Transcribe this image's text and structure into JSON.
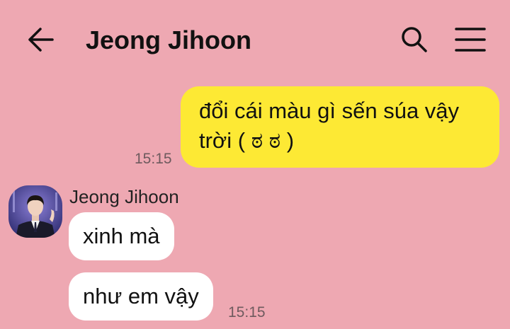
{
  "header": {
    "title": "Jeong Jihoon",
    "back_icon": "arrow-left-icon",
    "search_icon": "search-icon",
    "menu_icon": "hamburger-menu-icon"
  },
  "colors": {
    "background": "#eea8b2",
    "outgoing_bubble": "#fde934",
    "incoming_bubble": "#ffffff"
  },
  "messages": {
    "outgoing_1": {
      "line1": "đổi cái màu gì sến súa vậy",
      "line2": "trời ( ಠ ಠ )",
      "time": "15:15"
    },
    "incoming_group": {
      "sender": "Jeong Jihoon",
      "msg1": "xinh mà",
      "msg2": "như em vậy",
      "time": "15:15"
    }
  }
}
